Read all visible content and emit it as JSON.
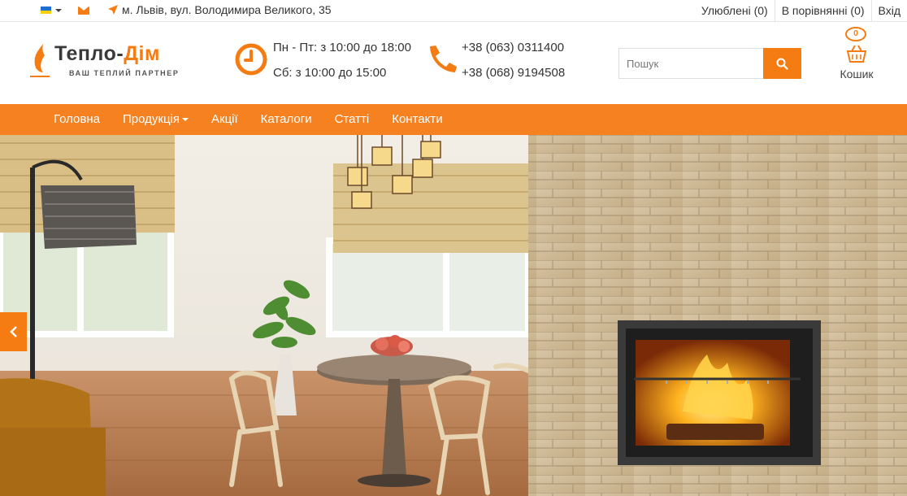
{
  "topbar": {
    "language_icon": "ukraine-flag-icon",
    "email_icon": "envelope-icon",
    "location_icon": "location-arrow-icon",
    "address": "м. Львів, вул. Володимира Великого, 35",
    "wishlist": "Улюблені (0)",
    "compare": "В порівнянні (0)",
    "login": "Вхід"
  },
  "header": {
    "logo_main": "Тепло-",
    "logo_accent": "Дім",
    "logo_tagline": "ВАШ ТЕПЛИЙ ПАРТНЕР",
    "hours_weekdays": "Пн - Пт: з 10:00 до 18:00",
    "hours_saturday": "Сб: з 10:00 до 15:00",
    "phone_1": "+38 (063) 0311400",
    "phone_2": "+38 (068) 9194508",
    "search_placeholder": "Пошук",
    "cart_count": "0",
    "cart_label": "Кошик"
  },
  "nav": {
    "items": [
      "Головна",
      "Продукція",
      "Акції",
      "Каталоги",
      "Статті",
      "Контакти"
    ]
  },
  "colors": {
    "accent": "#f47c13",
    "nav_bg": "#f68121",
    "text": "#333333"
  }
}
